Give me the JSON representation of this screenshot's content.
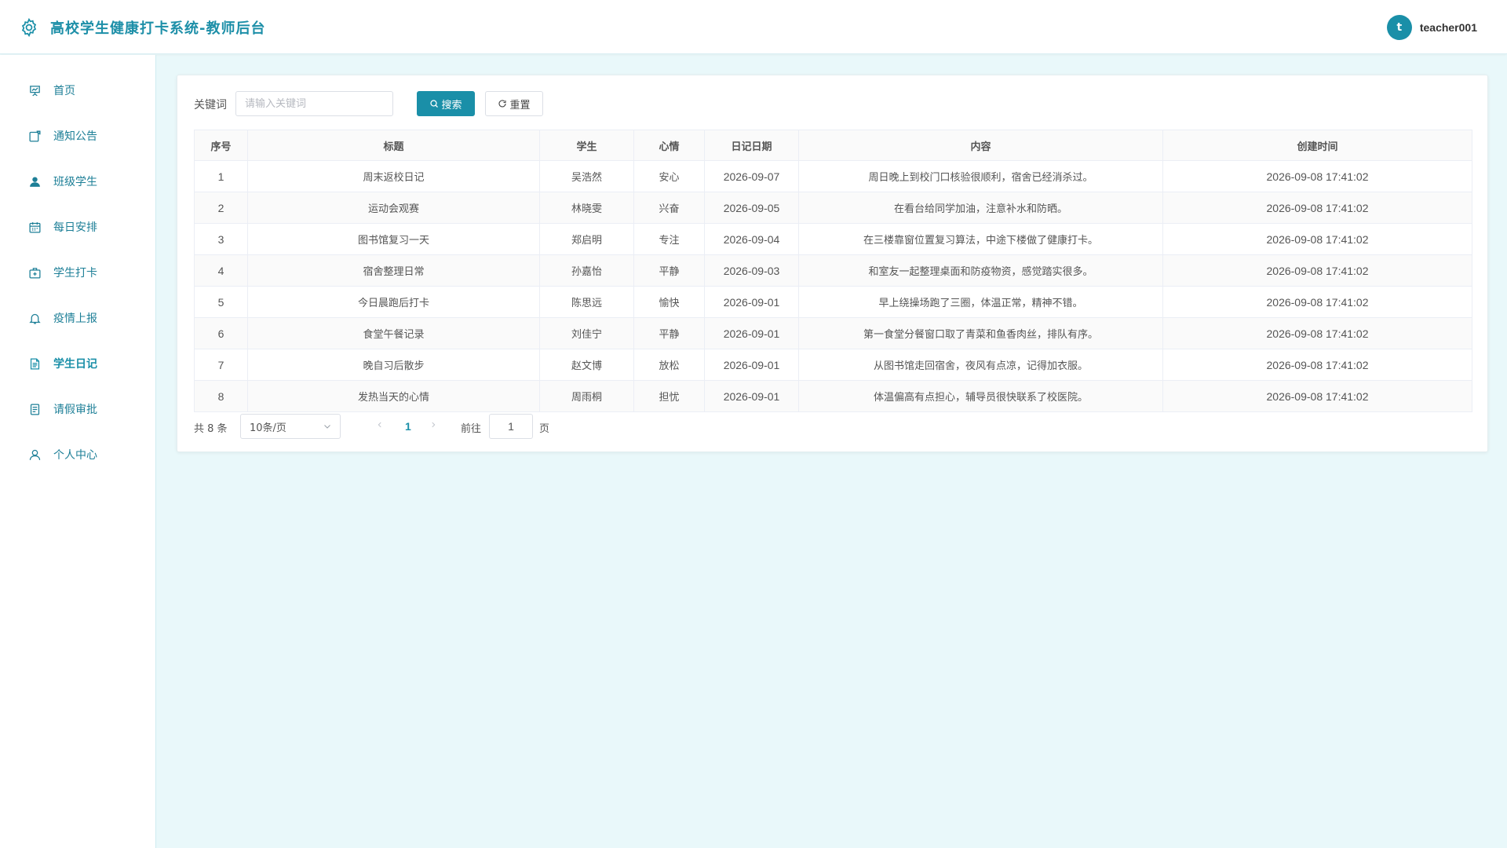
{
  "header": {
    "title": "高校学生健康打卡系统-教师后台",
    "avatar_letter": "t",
    "username": "teacher001"
  },
  "sidebar": {
    "items": [
      {
        "label": "首页",
        "icon": "presentation-icon"
      },
      {
        "label": "通知公告",
        "icon": "notice-icon"
      },
      {
        "label": "班级学生",
        "icon": "user-filled-icon"
      },
      {
        "label": "每日安排",
        "icon": "calendar-icon"
      },
      {
        "label": "学生打卡",
        "icon": "first-aid-icon"
      },
      {
        "label": "疫情上报",
        "icon": "bell-icon"
      },
      {
        "label": "学生日记",
        "icon": "document-icon",
        "active": true
      },
      {
        "label": "请假审批",
        "icon": "tickets-icon"
      },
      {
        "label": "个人中心",
        "icon": "user-icon"
      }
    ]
  },
  "filter": {
    "keyword_label": "关键词",
    "keyword_placeholder": "请输入关键词",
    "keyword_value": "",
    "search_label": "搜索",
    "reset_label": "重置"
  },
  "table": {
    "headers": [
      "序号",
      "标题",
      "学生",
      "心情",
      "日记日期",
      "内容",
      "创建时间"
    ],
    "rows": [
      [
        "1",
        "周末返校日记",
        "吴浩然",
        "安心",
        "2026-09-07",
        "周日晚上到校门口核验很顺利，宿舍已经消杀过。",
        "2026-09-08 17:41:02"
      ],
      [
        "2",
        "运动会观赛",
        "林晓雯",
        "兴奋",
        "2026-09-05",
        "在看台给同学加油，注意补水和防晒。",
        "2026-09-08 17:41:02"
      ],
      [
        "3",
        "图书馆复习一天",
        "郑启明",
        "专注",
        "2026-09-04",
        "在三楼靠窗位置复习算法，中途下楼做了健康打卡。",
        "2026-09-08 17:41:02"
      ],
      [
        "4",
        "宿舍整理日常",
        "孙嘉怡",
        "平静",
        "2026-09-03",
        "和室友一起整理桌面和防疫物资，感觉踏实很多。",
        "2026-09-08 17:41:02"
      ],
      [
        "5",
        "今日晨跑后打卡",
        "陈思远",
        "愉快",
        "2026-09-01",
        "早上绕操场跑了三圈，体温正常，精神不错。",
        "2026-09-08 17:41:02"
      ],
      [
        "6",
        "食堂午餐记录",
        "刘佳宁",
        "平静",
        "2026-09-01",
        "第一食堂分餐窗口取了青菜和鱼香肉丝，排队有序。",
        "2026-09-08 17:41:02"
      ],
      [
        "7",
        "晚自习后散步",
        "赵文博",
        "放松",
        "2026-09-01",
        "从图书馆走回宿舍，夜风有点凉，记得加衣服。",
        "2026-09-08 17:41:02"
      ],
      [
        "8",
        "发热当天的心情",
        "周雨桐",
        "担忧",
        "2026-09-01",
        "体温偏高有点担心，辅导员很快联系了校医院。",
        "2026-09-08 17:41:02"
      ]
    ]
  },
  "pagination": {
    "total_text": "共 8 条",
    "page_size": "10条/页",
    "current_page": "1",
    "goto_label": "前往",
    "goto_value": "1",
    "page_unit": "页"
  },
  "colors": {
    "accent": "#1a8fa8",
    "background": "#e9f8fa"
  }
}
